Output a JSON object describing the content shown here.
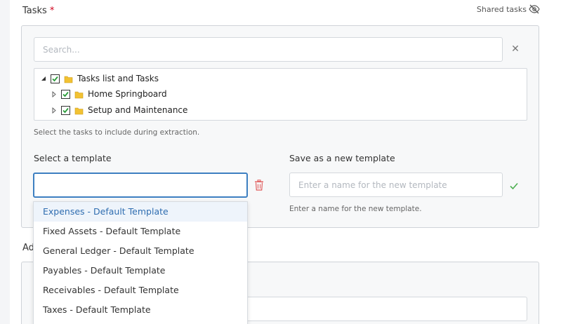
{
  "tasks_section": {
    "label": "Tasks",
    "required_mark": "*",
    "shared_tasks_label": "Shared tasks",
    "shared_icon": "eye-slash-icon"
  },
  "search": {
    "placeholder": "Search...",
    "value": ""
  },
  "tree": {
    "root": {
      "label": "Tasks list and Tasks",
      "expanded": true,
      "checked": true
    },
    "children": [
      {
        "label": "Home Springboard",
        "expanded": false,
        "checked": true
      },
      {
        "label": "Setup and Maintenance",
        "expanded": false,
        "checked": true
      }
    ]
  },
  "tree_hint": "Select the tasks to include during extraction.",
  "template": {
    "label": "Select a template",
    "value": "",
    "options": [
      "Expenses - Default Template",
      "Fixed Assets - Default Template",
      "General Ledger - Default Template",
      "Payables - Default Template",
      "Receivables - Default Template",
      "Taxes - Default Template"
    ],
    "highlighted_index": 0
  },
  "new_template": {
    "label": "Save as a new template",
    "placeholder": "Enter a name for the new template",
    "hint": "Enter a name for the new template."
  },
  "second_section": {
    "label_visible": "Ad"
  },
  "colors": {
    "accent": "#3d7fc1",
    "required": "#d0021b",
    "delete": "#e05a5a",
    "confirm": "#4caf50",
    "folder": "#f2c233",
    "highlight_bg": "#eef4fb"
  }
}
